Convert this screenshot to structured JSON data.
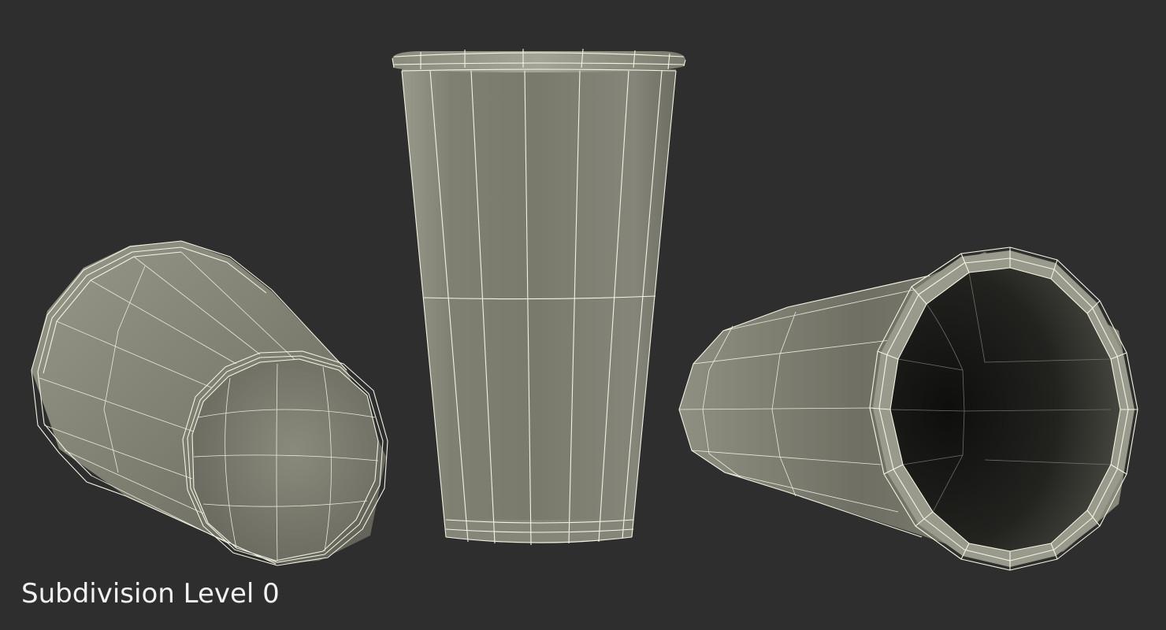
{
  "caption": "Subdivision Level 0",
  "colors": {
    "background": "#2e2e2e",
    "surface": "#8a8a7c",
    "wireframe": "#f4f4e4",
    "interior": "#1a1a18"
  },
  "objects": [
    {
      "name": "cup-upright"
    },
    {
      "name": "cup-lying-left-bottom-view"
    },
    {
      "name": "cup-lying-right-open-view"
    }
  ]
}
